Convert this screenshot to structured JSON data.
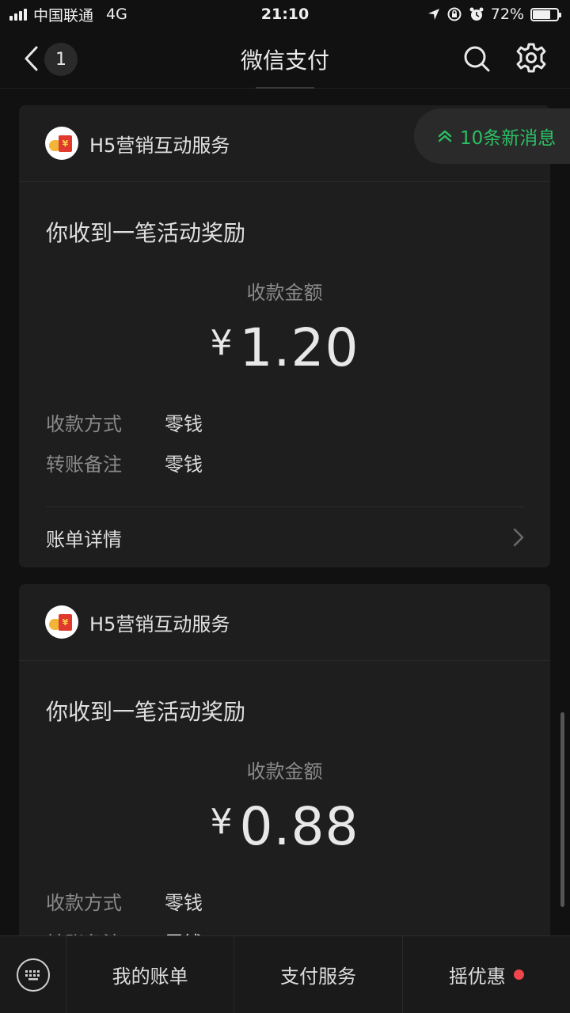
{
  "status_bar": {
    "carrier": "中国联通",
    "network": "4G",
    "time": "21:10",
    "battery": "72%",
    "battery_level": 0.72
  },
  "nav": {
    "unread_count": "1",
    "title": "微信支付",
    "icons": [
      "back-icon",
      "search-icon",
      "gear-icon"
    ]
  },
  "new_messages": {
    "label": "10条新消息",
    "icon": "double-chevron-up-icon"
  },
  "cards": [
    {
      "app_name": "H5营销互动服务",
      "title": "你收到一笔活动奖励",
      "amount_label": "收款金额",
      "currency": "¥",
      "amount": "1.20",
      "rows": [
        {
          "key": "收款方式",
          "value": "零钱"
        },
        {
          "key": "转账备注",
          "value": "零钱"
        }
      ],
      "detail_label": "账单详情"
    },
    {
      "app_name": "H5营销互动服务",
      "title": "你收到一笔活动奖励",
      "amount_label": "收款金额",
      "currency": "¥",
      "amount": "0.88",
      "rows": [
        {
          "key": "收款方式",
          "value": "零钱"
        },
        {
          "key": "转账备注",
          "value": "零钱"
        }
      ]
    }
  ],
  "bottom_bar": {
    "items": [
      "我的账单",
      "支付服务",
      "摇优惠"
    ]
  },
  "colors": {
    "accent_green": "#2bc064",
    "badge_red": "#f0454a",
    "background": "#111111",
    "card": "#1e1e1e"
  }
}
